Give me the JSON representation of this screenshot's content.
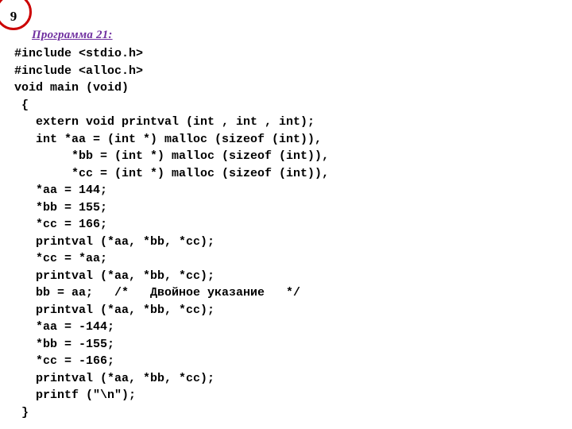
{
  "slide": {
    "background_color": "#ffffff",
    "badge": {
      "number": "9",
      "ring_color": "#cc0000",
      "text_color": "#000000",
      "icon_name": "slide-number-circle"
    },
    "heading": {
      "text": "Программа 21:",
      "color": "#7030a0"
    }
  },
  "code": {
    "language": "c",
    "text_color": "#000000",
    "lines": [
      "#include <stdio.h>",
      "#include <alloc.h>",
      "void main (void)",
      " {",
      "   extern void printval (int , int , int);",
      "   int *aa = (int *) malloc (sizeof (int)),",
      "        *bb = (int *) malloc (sizeof (int)),",
      "        *cc = (int *) malloc (sizeof (int)),",
      "   *aa = 144;",
      "   *bb = 155;",
      "   *cc = 166;",
      "   printval (*aa, *bb, *cc);",
      "   *cc = *aa;",
      "   printval (*aa, *bb, *cc);",
      "   bb = aa;   /*   Двойное указание   */",
      "   printval (*aa, *bb, *cc);",
      "   *aa = -144;",
      "   *bb = -155;",
      "   *cc = -166;",
      "   printval (*aa, *bb, *cc);",
      "   printf (\"\\n\");",
      " }"
    ]
  }
}
